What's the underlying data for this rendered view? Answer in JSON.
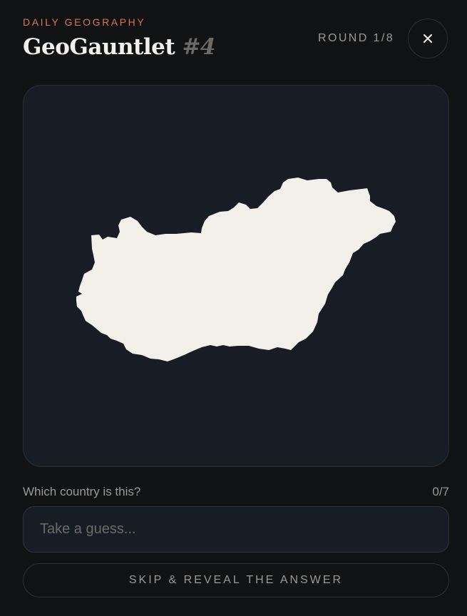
{
  "header": {
    "eyebrow": "DAILY GEOGRAPHY",
    "title": "GeoGauntlet",
    "number": "#4",
    "round": "ROUND 1/8",
    "close_icon": "close-icon"
  },
  "map": {
    "shape_icon": "country-silhouette",
    "land_color": "#f3efe9",
    "card_color": "#181c24"
  },
  "question": {
    "prompt": "Which country is this?",
    "guess_count": "0/7"
  },
  "guess": {
    "placeholder": "Take a guess...",
    "value": ""
  },
  "actions": {
    "skip_label": "SKIP & REVEAL THE ANSWER"
  },
  "colors": {
    "background": "#111214",
    "accent": "#d9774d",
    "muted_text": "#9c9891"
  }
}
